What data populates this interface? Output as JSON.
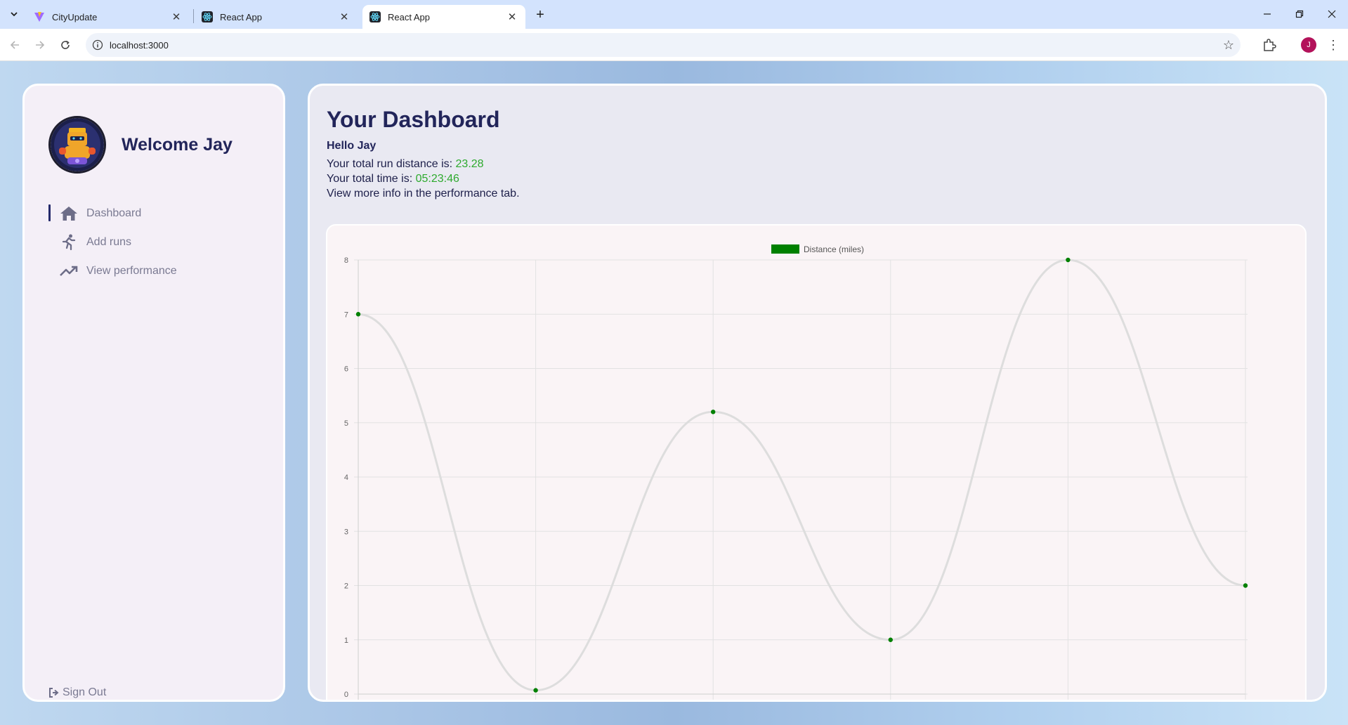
{
  "browser": {
    "tabs": [
      {
        "label": "CityUpdate",
        "icon": "vite-icon",
        "active": false
      },
      {
        "label": "React App",
        "icon": "react-icon",
        "active": false
      },
      {
        "label": "React App",
        "icon": "react-icon",
        "active": true
      }
    ],
    "url": "localhost:3000",
    "profile_initial": "J"
  },
  "sidebar": {
    "welcome": "Welcome Jay",
    "nav": [
      {
        "label": "Dashboard",
        "icon": "home-icon",
        "active": true
      },
      {
        "label": "Add runs",
        "icon": "runner-icon",
        "active": false
      },
      {
        "label": "View performance",
        "icon": "trending-up-icon",
        "active": false
      }
    ],
    "sign_out": "Sign Out"
  },
  "main": {
    "title": "Your Dashboard",
    "greeting": "Hello Jay",
    "distance_label": "Your total run distance is: ",
    "distance_value": "23.28",
    "time_label": "Your total time is: ",
    "time_value": "05:23:46",
    "info_text": "View more info in the performance tab."
  },
  "colors": {
    "accent_navy": "#22255a",
    "value_green": "#2eaa2e",
    "series_green": "#008000",
    "line_grey": "#dddddd"
  },
  "chart_data": {
    "type": "line",
    "title": "",
    "xlabel": "",
    "ylabel": "",
    "ylim": [
      0,
      8
    ],
    "yticks": [
      "8",
      "7",
      "6",
      "5",
      "4",
      "3",
      "2",
      "1",
      "0"
    ],
    "legend": "top-center",
    "grid": true,
    "series": [
      {
        "name": "Distance (miles)",
        "values": [
          7,
          0.07,
          5.2,
          1,
          8,
          2
        ],
        "color": "#008000"
      }
    ]
  }
}
